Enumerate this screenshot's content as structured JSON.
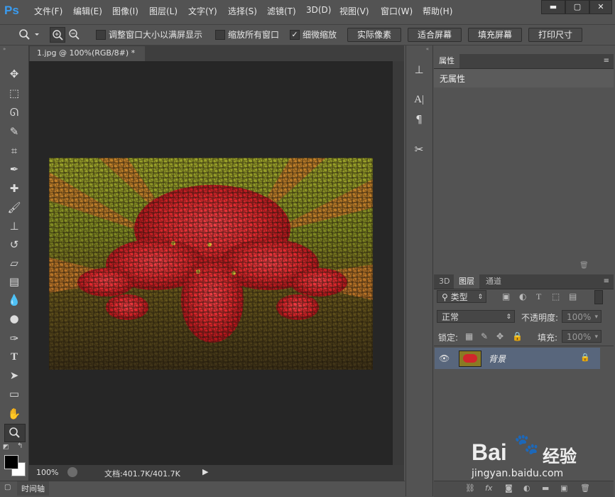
{
  "app": {
    "logo": "Ps"
  },
  "menu": [
    "文件(F)",
    "编辑(E)",
    "图像(I)",
    "图层(L)",
    "文字(Y)",
    "选择(S)",
    "滤镜(T)",
    "3D(D)",
    "视图(V)",
    "窗口(W)",
    "帮助(H)"
  ],
  "window_controls": {
    "minimize": "▬",
    "restore": "▢",
    "close": "✕"
  },
  "options": {
    "resize_window": "调整窗口大小以满屏显示",
    "zoom_all": "缩放所有窗口",
    "scrubby_zoom": "细微缩放",
    "scrubby_checked": true,
    "actual_pixels": "实际像素",
    "fit_screen": "适合屏幕",
    "fill_screen": "填充屏幕",
    "print_size": "打印尺寸"
  },
  "document": {
    "tab_title": "1.jpg @ 100%(RGB/8#) *",
    "tab_close": "×",
    "zoom": "100%",
    "doc_size": "文档:401.7K/401.7K"
  },
  "timeline": {
    "label": "时间轴"
  },
  "properties": {
    "tab": "属性",
    "empty_text": "无属性"
  },
  "layers": {
    "tabs": [
      "3D",
      "图层",
      "通道"
    ],
    "active_tab": 1,
    "filter_kind": "类型",
    "blend_mode": "正常",
    "opacity_label": "不透明度:",
    "opacity_value": "100%",
    "lock_label": "锁定:",
    "fill_label": "填充:",
    "fill_value": "100%",
    "layer_name": "背景"
  },
  "watermark": {
    "brand": "Bai",
    "brand2": "经验",
    "url": "jingyan.baidu.com"
  },
  "colors": {
    "accent": "#3a9cf0",
    "selected_layer": "#58667c",
    "panel": "#535353",
    "canvas_bg": "#262626"
  }
}
